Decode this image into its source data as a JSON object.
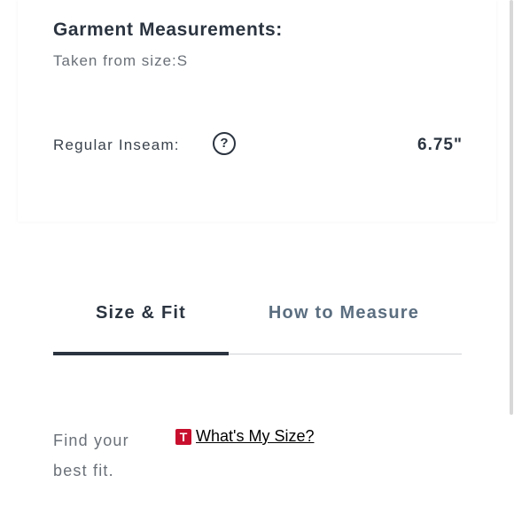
{
  "measurements": {
    "title": "Garment Measurements:",
    "subtitle": "Taken from size:S",
    "rows": [
      {
        "label": "Regular Inseam:",
        "help_glyph": "?",
        "value": "6.75\""
      }
    ]
  },
  "tabs": [
    {
      "label": "Size & Fit",
      "active": true
    },
    {
      "label": "How to Measure",
      "active": false
    }
  ],
  "fit": {
    "text": "Find your best fit.",
    "logo_letter": "T",
    "link_label": "What's My Size?",
    "logo_color": "#c8102e"
  },
  "colors": {
    "text_dark": "#2b3440",
    "text_muted": "#6a7078",
    "tab_inactive": "#5b6e80"
  },
  "icons": {
    "help": "help-circle-icon",
    "logo": "t-brand-logo-icon"
  }
}
